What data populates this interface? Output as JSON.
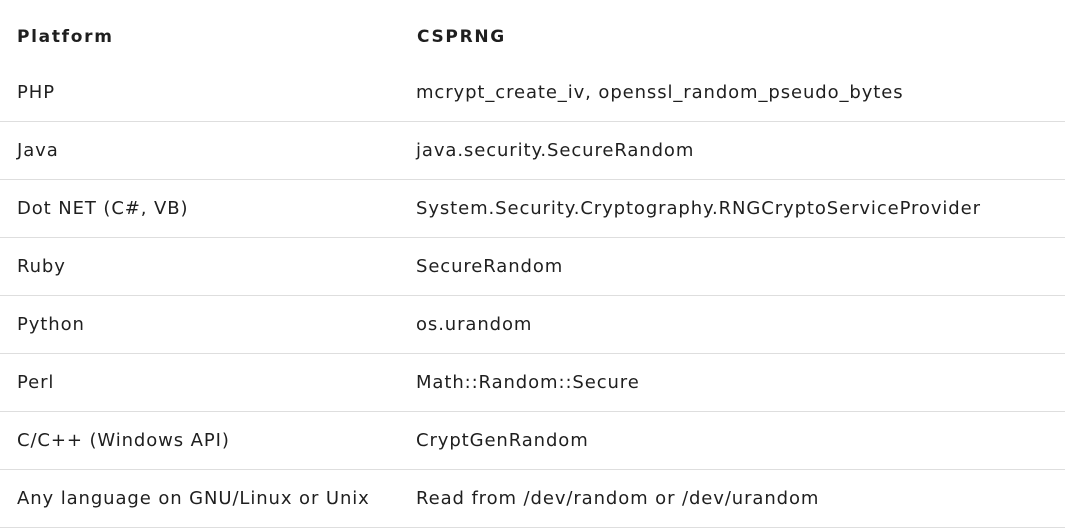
{
  "table": {
    "headers": [
      "Platform",
      "CSPRNG"
    ],
    "rows": [
      [
        "PHP",
        "mcrypt_create_iv, openssl_random_pseudo_bytes"
      ],
      [
        "Java",
        "java.security.SecureRandom"
      ],
      [
        "Dot NET (C#, VB)",
        "System.Security.Cryptography.RNGCryptoServiceProvider"
      ],
      [
        "Ruby",
        "SecureRandom"
      ],
      [
        "Python",
        "os.urandom"
      ],
      [
        "Perl",
        "Math::Random::Secure"
      ],
      [
        "C/C++ (Windows API)",
        "CryptGenRandom"
      ],
      [
        "Any language on GNU/Linux or Unix",
        "Read from /dev/random or /dev/urandom"
      ]
    ]
  }
}
